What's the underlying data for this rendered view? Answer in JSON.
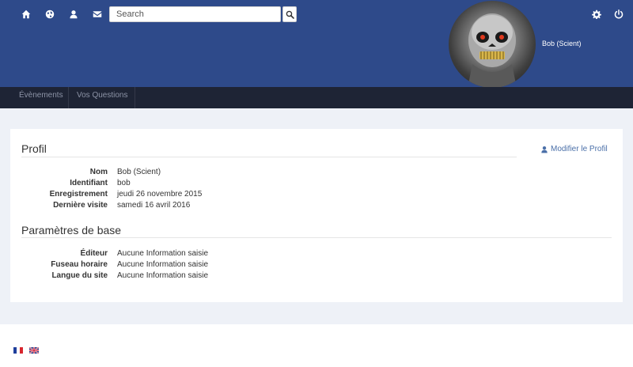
{
  "search": {
    "placeholder": "Search"
  },
  "user": {
    "name": "Bob (Scient)"
  },
  "nav": {
    "items": [
      {
        "label": "Évènements"
      },
      {
        "label": "Vos Questions"
      }
    ]
  },
  "profile": {
    "title": "Profil",
    "edit_label": "Modifier le Profil",
    "fields": [
      {
        "key": "Nom",
        "value": "Bob (Scient)"
      },
      {
        "key": "Identifiant",
        "value": "bob"
      },
      {
        "key": "Enregistrement",
        "value": "jeudi 26 novembre 2015"
      },
      {
        "key": "Dernière visite",
        "value": "samedi 16 avril 2016"
      }
    ]
  },
  "basic": {
    "title": "Paramètres de base",
    "fields": [
      {
        "key": "Éditeur",
        "value": "Aucune Information saisie"
      },
      {
        "key": "Fuseau horaire",
        "value": "Aucune Information saisie"
      },
      {
        "key": "Langue du site",
        "value": "Aucune Information saisie"
      }
    ]
  },
  "icons": {
    "top_left": [
      "home-icon",
      "globe-icon",
      "user-icon",
      "mail-icon"
    ],
    "top_right": [
      "gear-icon",
      "power-icon"
    ]
  },
  "colors": {
    "header": "#2e4a8a",
    "navbar": "#1e2435",
    "content_bg": "#eef1f7",
    "link": "#4a6fa8"
  }
}
